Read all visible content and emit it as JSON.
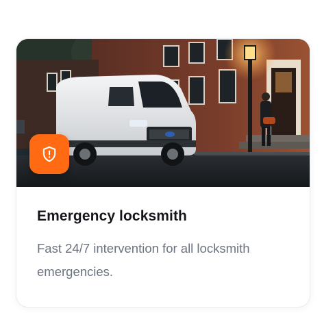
{
  "card": {
    "title": "Emergency locksmith",
    "description": "Fast 24/7 intervention for all locksmith emergencies.",
    "badge_icon": "shield-exclamation-icon",
    "accent_color": "#ff6a13"
  }
}
